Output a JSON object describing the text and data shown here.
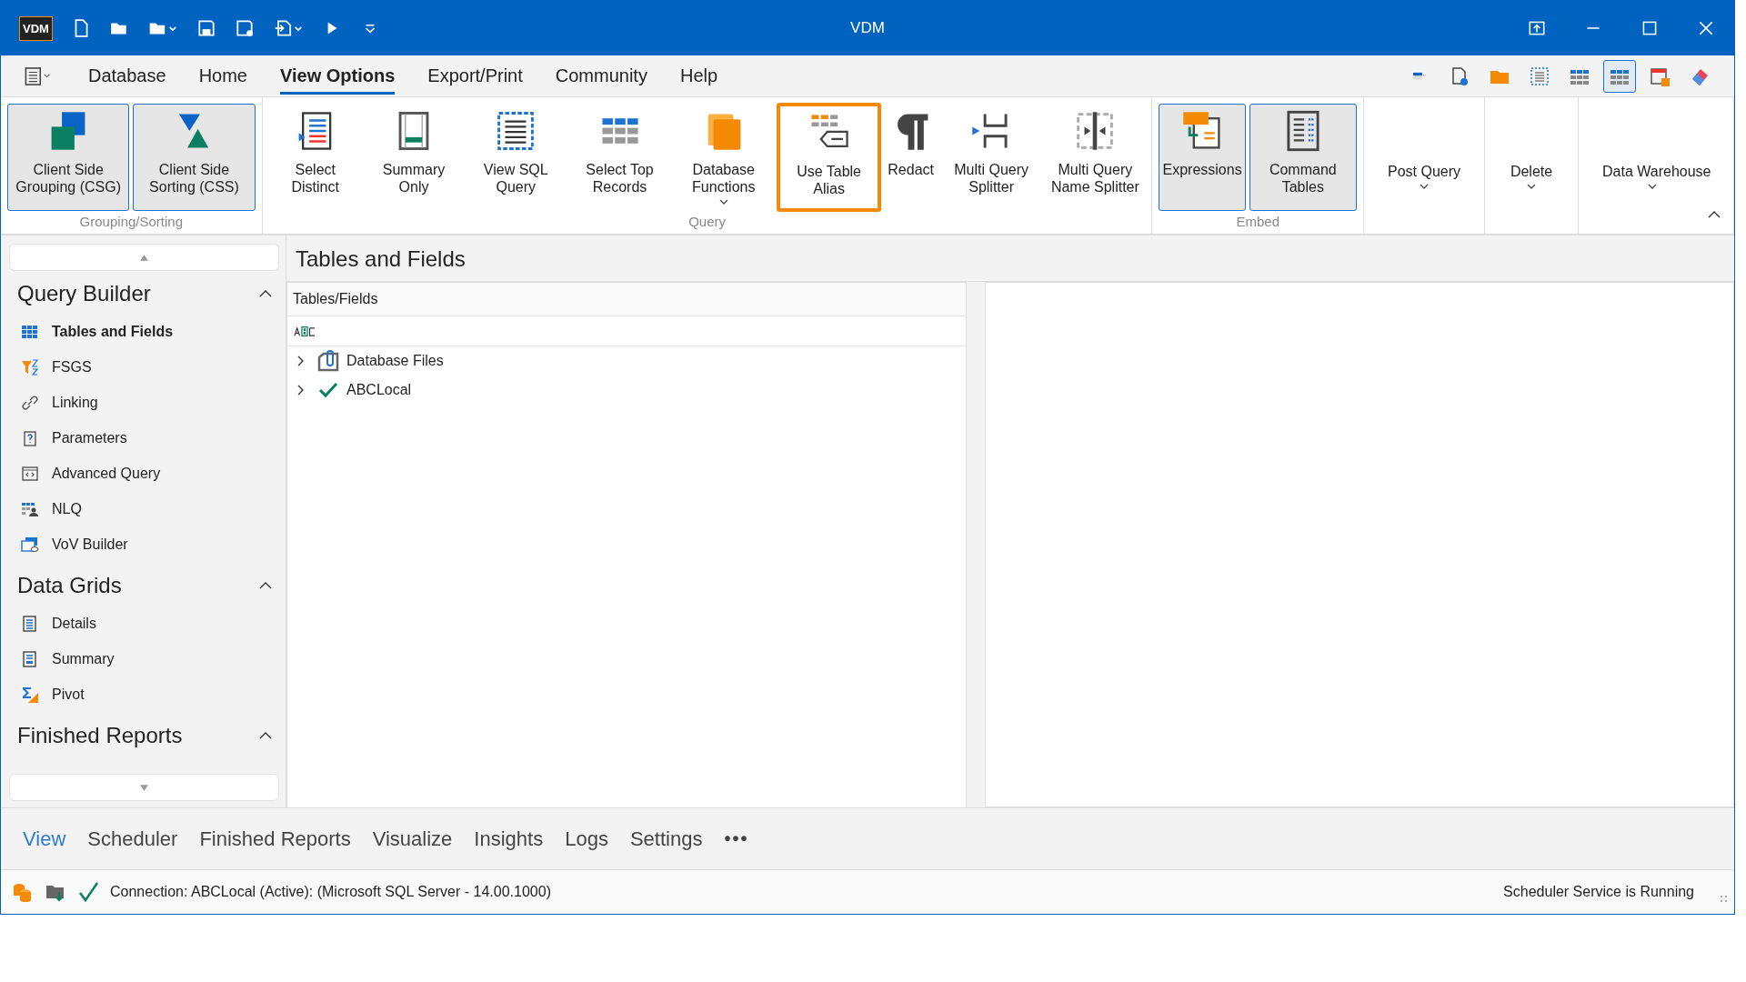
{
  "window": {
    "logo": "VDM",
    "title": "VDM"
  },
  "menu_tabs": [
    {
      "label": "Database",
      "selected": false
    },
    {
      "label": "Home",
      "selected": false
    },
    {
      "label": "View Options",
      "selected": true
    },
    {
      "label": "Export/Print",
      "selected": false
    },
    {
      "label": "Community",
      "selected": false
    },
    {
      "label": "Help",
      "selected": false
    }
  ],
  "toolbar_tools": [
    {
      "selected": false
    },
    {
      "selected": false
    },
    {
      "selected": false
    },
    {
      "selected": false
    },
    {
      "selected": false
    },
    {
      "selected": true
    },
    {
      "selected": false
    },
    {
      "selected": false
    }
  ],
  "ribbon_groups": [
    {
      "label": "Grouping/Sorting",
      "buttons": [
        {
          "label": "Client Side Grouping (CSG)",
          "selected": true,
          "highlighted": false,
          "dropdown": false
        },
        {
          "label": "Client Side Sorting (CSS)",
          "selected": true,
          "highlighted": false,
          "dropdown": false
        }
      ]
    },
    {
      "label": "Query",
      "buttons": [
        {
          "label": "Select Distinct",
          "selected": false,
          "highlighted": false,
          "dropdown": false
        },
        {
          "label": "Summary Only",
          "selected": false,
          "highlighted": false,
          "dropdown": false
        },
        {
          "label": "View SQL Query",
          "selected": false,
          "highlighted": false,
          "dropdown": false
        },
        {
          "label": "Select Top Records",
          "selected": false,
          "highlighted": false,
          "dropdown": false
        },
        {
          "label": "Database Functions",
          "selected": false,
          "highlighted": false,
          "dropdown": true
        },
        {
          "label": "Use Table Alias",
          "selected": false,
          "highlighted": true,
          "dropdown": false
        },
        {
          "label": "Redact",
          "selected": false,
          "highlighted": false,
          "dropdown": false
        },
        {
          "label": "Multi Query Splitter",
          "selected": false,
          "highlighted": false,
          "dropdown": false
        },
        {
          "label": "Multi Query Name Splitter",
          "selected": false,
          "highlighted": false,
          "dropdown": false
        }
      ]
    },
    {
      "label": "Embed",
      "buttons": [
        {
          "label": "Expressions",
          "selected": true,
          "highlighted": false,
          "dropdown": false
        },
        {
          "label": "Command Tables",
          "selected": true,
          "highlighted": false,
          "dropdown": false
        }
      ]
    },
    {
      "buttons": [
        {
          "label": "Post Query",
          "selected": false,
          "highlighted": false,
          "dropdown": true
        }
      ]
    },
    {
      "buttons": [
        {
          "label": "Delete",
          "selected": false,
          "highlighted": false,
          "dropdown": true
        }
      ]
    },
    {
      "buttons": [
        {
          "label": "Data Warehouse",
          "selected": false,
          "highlighted": false,
          "dropdown": true
        }
      ]
    }
  ],
  "sidebar": {
    "sections": [
      {
        "title": "Query Builder",
        "expanded": true,
        "items": [
          {
            "label": "Tables and Fields",
            "selected": true
          },
          {
            "label": "FSGS",
            "selected": false
          },
          {
            "label": "Linking",
            "selected": false
          },
          {
            "label": "Parameters",
            "selected": false
          },
          {
            "label": "Advanced Query",
            "selected": false
          },
          {
            "label": "NLQ",
            "selected": false
          },
          {
            "label": "VoV Builder",
            "selected": false
          }
        ]
      },
      {
        "title": "Data Grids",
        "expanded": true,
        "items": [
          {
            "label": "Details",
            "selected": false
          },
          {
            "label": "Summary",
            "selected": false
          },
          {
            "label": "Pivot",
            "selected": false
          }
        ]
      },
      {
        "title": "Finished Reports",
        "expanded": true
      }
    ]
  },
  "main": {
    "title": "Tables and Fields",
    "tree": {
      "column": "Tables/Fields",
      "nodes": [
        {
          "label": "Database Files",
          "expanded": false
        },
        {
          "label": "ABCLocal",
          "expanded": false
        }
      ]
    }
  },
  "bottom_tabs": [
    {
      "label": "View",
      "selected": true
    },
    {
      "label": "Scheduler",
      "selected": false
    },
    {
      "label": "Finished Reports",
      "selected": false
    },
    {
      "label": "Visualize",
      "selected": false
    },
    {
      "label": "Insights",
      "selected": false
    },
    {
      "label": "Logs",
      "selected": false
    },
    {
      "label": "Settings",
      "selected": false
    }
  ],
  "more_tabs": "•••",
  "status_bar": {
    "connection": "Connection: ABCLocal (Active): (Microsoft SQL Server - 14.00.1000)",
    "service": "Scheduler Service is Running"
  }
}
